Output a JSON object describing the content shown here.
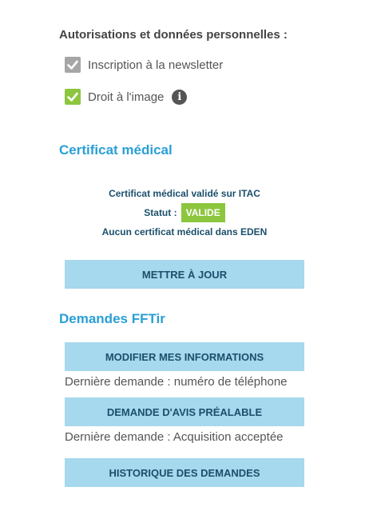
{
  "permissions": {
    "title": "Autorisations et données personnelles :",
    "newsletter": {
      "label": "Inscription à la newsletter",
      "checked": true,
      "color": "#a6a6a6",
      "icon": "check-icon"
    },
    "image_right": {
      "label": "Droit à l'image",
      "checked": true,
      "color": "#8cc63f",
      "icon": "check-icon"
    },
    "info_icon": "i"
  },
  "medical": {
    "title": "Certificat médical",
    "itac_line": "Certificat médical validé sur ITAC",
    "statut_label": "Statut :",
    "statut_value": "VALIDE",
    "eden_line": "Aucun certificat médical dans EDEN",
    "update_button": "METTRE À JOUR"
  },
  "requests": {
    "title": "Demandes FFTir",
    "modify_button": "MODIFIER MES INFORMATIONS",
    "modify_last": "Dernière demande : numéro de téléphone",
    "prior_button": "DEMANDE D'AVIS PRÉALABLE",
    "prior_last": "Dernière demande : Acquisition acceptée",
    "history_button": "HISTORIQUE DES DEMANDES"
  },
  "colors": {
    "accent": "#2a9fd6",
    "button_bg": "#a6d8ee",
    "button_text": "#1b4f6b",
    "valid_badge": "#8cc63f"
  }
}
